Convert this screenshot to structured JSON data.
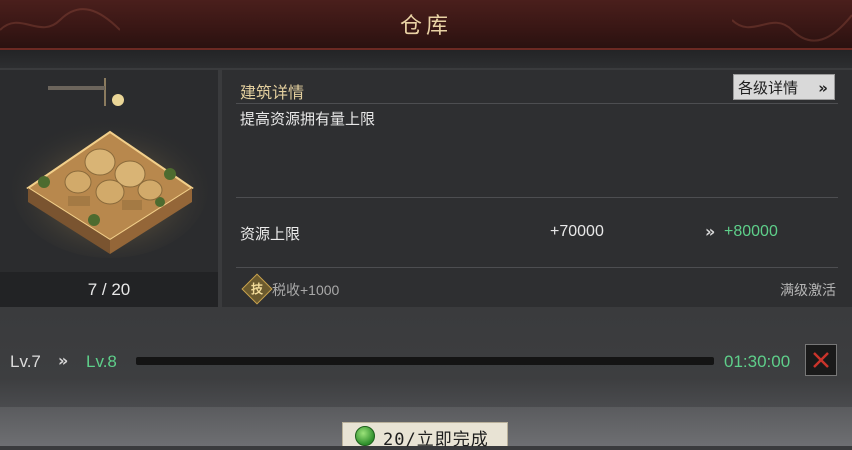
{
  "header": {
    "title": "仓库"
  },
  "building": {
    "count_label": "7 / 20"
  },
  "details": {
    "section_title": "建筑详情",
    "levels_button": "各级详情",
    "levels_chevron": "»",
    "description": "提高资源拥有量上限",
    "resource_label": "资源上限",
    "resource_current": "+70000",
    "resource_arrow": "»",
    "resource_next": "+80000",
    "tech_badge": "技",
    "tech_bonus": "税收+1000",
    "max_level_note": "满级激活"
  },
  "upgrade": {
    "current_level": "Lv.7",
    "arrow": "»",
    "next_level": "Lv.8",
    "timer": "01:30:00",
    "progress": 0
  },
  "finish": {
    "label": "20/立即完成"
  },
  "colors": {
    "accent_green": "#5ecf8a",
    "title_gold": "#e3cf9e",
    "cancel_red": "#c9342b"
  }
}
